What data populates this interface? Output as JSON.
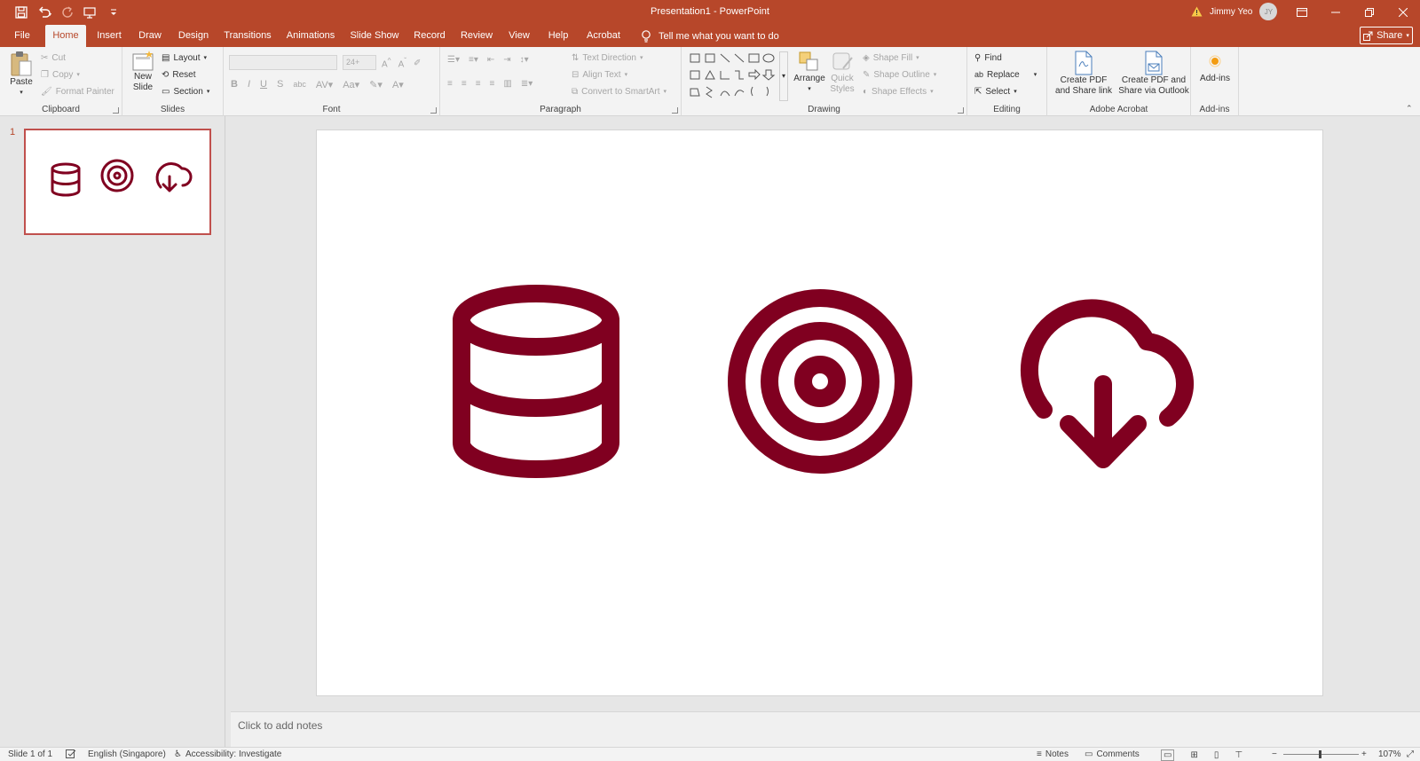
{
  "titlebar": {
    "title": "Presentation1 - PowerPoint",
    "user_name": "Jimmy Yeo",
    "user_initials": "JY",
    "accent_color": "#b7472a"
  },
  "tabs": [
    "File",
    "Home",
    "Insert",
    "Draw",
    "Design",
    "Transitions",
    "Animations",
    "Slide Show",
    "Record",
    "Review",
    "View",
    "Help",
    "Acrobat"
  ],
  "active_tab": "Home",
  "tell_me": "Tell me what you want to do",
  "share": "Share",
  "ribbon": {
    "clipboard": {
      "label": "Clipboard",
      "paste": "Paste",
      "cut": "Cut",
      "copy": "Copy",
      "format_painter": "Format Painter"
    },
    "slides": {
      "label": "Slides",
      "new_slide_1": "New",
      "new_slide_2": "Slide",
      "layout": "Layout",
      "reset": "Reset",
      "section": "Section"
    },
    "font": {
      "label": "Font",
      "size": "24+"
    },
    "paragraph": {
      "label": "Paragraph",
      "text_direction": "Text Direction",
      "align_text": "Align Text",
      "convert_smartart": "Convert to SmartArt"
    },
    "drawing": {
      "label": "Drawing",
      "arrange": "Arrange",
      "quick_styles_1": "Quick",
      "quick_styles_2": "Styles",
      "shape_fill": "Shape Fill",
      "shape_outline": "Shape Outline",
      "shape_effects": "Shape Effects"
    },
    "editing": {
      "label": "Editing",
      "find": "Find",
      "replace": "Replace",
      "select": "Select"
    },
    "acrobat": {
      "label": "Adobe Acrobat",
      "create_link_1": "Create PDF",
      "create_link_2": "and Share link",
      "create_outlook_1": "Create PDF and",
      "create_outlook_2": "Share via Outlook"
    },
    "addins": {
      "label": "Add-ins",
      "addins_btn": "Add-ins"
    }
  },
  "thumbnails": [
    {
      "number": "1"
    }
  ],
  "slide": {
    "icon_color": "#800020",
    "icons": [
      "database-icon",
      "target-icon",
      "cloud-download-icon"
    ]
  },
  "notes_placeholder": "Click to add notes",
  "statusbar": {
    "slide_count": "Slide 1 of 1",
    "language": "English (Singapore)",
    "accessibility": "Accessibility: Investigate",
    "notes": "Notes",
    "comments": "Comments",
    "zoom": "107%"
  }
}
